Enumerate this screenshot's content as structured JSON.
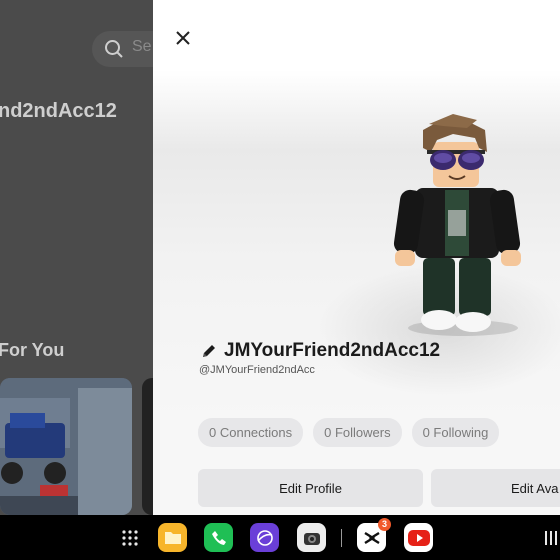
{
  "background_app": {
    "search_placeholder": "Se",
    "username": "nd2ndAcc12",
    "section_title": "For You"
  },
  "profile": {
    "display_name": "JMYourFriend2ndAcc12",
    "handle": "@JMYourFriend2ndAcc",
    "stats": {
      "connections": "0 Connections",
      "followers": "0 Followers",
      "following": "0 Following"
    },
    "buttons": {
      "edit_profile": "Edit Profile",
      "edit_avatar": "Edit Ava"
    }
  },
  "taskbar": {
    "apps": [
      "apps-grid-icon",
      "files-icon",
      "phone-icon",
      "browser-icon",
      "camera-icon",
      "capcut-icon",
      "youtube-icon"
    ],
    "capcut_badge": "3"
  },
  "colors": {
    "panel_bg": "#f6f6f6",
    "pill_bg": "#e7e7e9",
    "dim_bg": "#4b4b4b",
    "phone_green": "#1fbf55",
    "files_yellow": "#f7b52b",
    "youtube_red": "#e62117"
  }
}
